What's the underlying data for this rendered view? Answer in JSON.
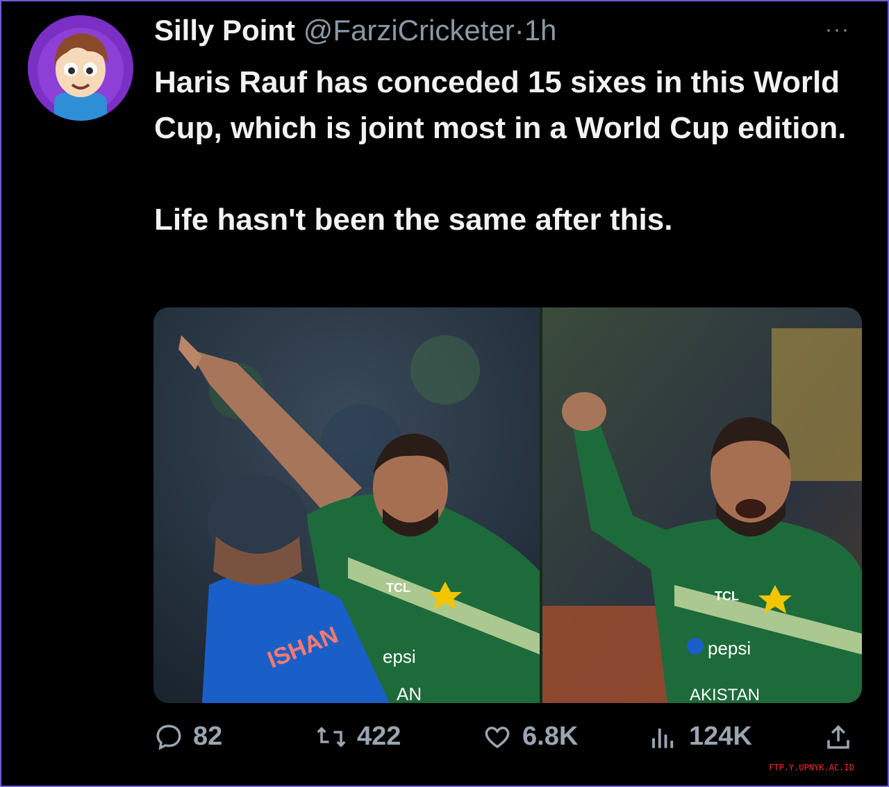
{
  "tweet": {
    "display_name": "Silly Point",
    "handle": "@FarziCricketer",
    "separator": "·",
    "time": "1h",
    "more_label": "···",
    "lines": [
      "Haris Rauf has conceded 15 sixes in this World Cup, which is joint most in a World Cup edition.",
      "Life hasn't been the same after this."
    ]
  },
  "media": {
    "left_jersey_text": "ISHAN",
    "left_sponsor": "epsi",
    "left_team": "AN",
    "right_sponsor": "pepsi",
    "right_team": "AKISTAN",
    "left_logo": "TCL",
    "right_logo": "TCL"
  },
  "actions": {
    "replies": "82",
    "retweets": "422",
    "likes": "6.8K",
    "views": "124K"
  },
  "watermark": "FTP.Y.UPNYK.AC.ID",
  "colors": {
    "background": "#000000",
    "border": "#6b5fd8",
    "avatar_bg": "#7b2fc4",
    "jersey_green": "#1d6b3a",
    "jersey_blue": "#1a5fc8",
    "watermark": "#ff2b2b"
  },
  "icons": [
    "more-icon",
    "reply-icon",
    "retweet-icon",
    "like-icon",
    "views-icon",
    "share-icon"
  ]
}
